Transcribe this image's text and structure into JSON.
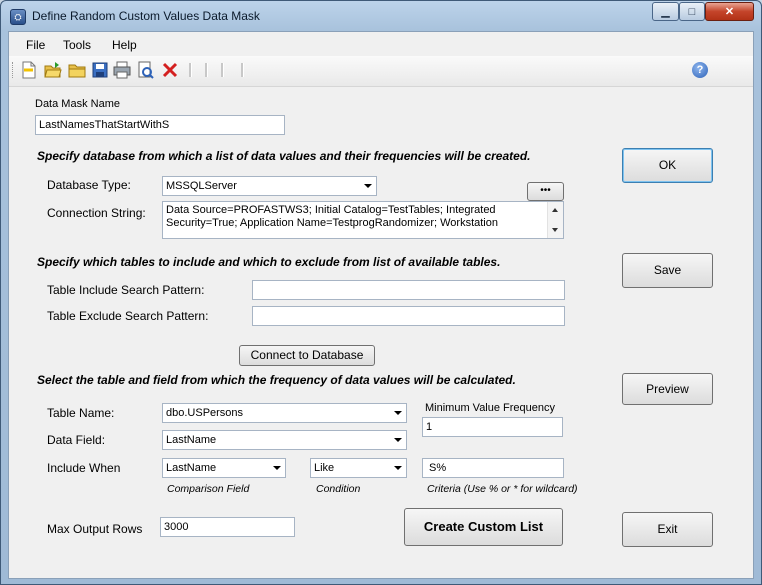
{
  "window": {
    "title": "Define Random Custom Values Data Mask",
    "min_glyph": "▁",
    "max_glyph": "□",
    "close_glyph": "✕"
  },
  "menu": {
    "items": [
      "File",
      "Tools",
      "Help"
    ]
  },
  "toolbar": {
    "icons": [
      "new-document-icon",
      "open-folder-icon",
      "folder-icon",
      "save-icon",
      "print-icon",
      "print-preview-icon",
      "delete-icon",
      "help-icon"
    ],
    "help_glyph": "?"
  },
  "form": {
    "mask_name_label": "Data Mask Name",
    "mask_name_value": "LastNamesThatStartWithS",
    "db_heading": "Specify database from which a list of data values and their frequencies will be created.",
    "db_type_label": "Database Type:",
    "db_type_value": "MSSQLServer",
    "browse_button": "•••",
    "conn_label": "Connection String:",
    "conn_value": "Data Source=PROFASTWS3; Initial Catalog=TestTables; Integrated Security=True; Application Name=TestprogRandomizer; Workstation",
    "tables_heading": "Specify which tables to include and which to exclude from list of available tables.",
    "include_label": "Table Include Search Pattern:",
    "include_value": "",
    "exclude_label": "Table Exclude Search Pattern:",
    "exclude_value": "",
    "connect_button": "Connect to Database",
    "field_heading": "Select the table and field from which the frequency of data values will be calculated.",
    "table_name_label": "Table Name:",
    "table_name_value": "dbo.USPersons",
    "min_freq_label": "Minimum Value Frequency",
    "min_freq_value": "1",
    "data_field_label": "Data Field:",
    "data_field_value": "LastName",
    "include_when_label": "Include When",
    "comparison_value": "LastName",
    "condition_value": "Like",
    "criteria_value": "S%",
    "comparison_caption": "Comparison Field",
    "condition_caption": "Condition",
    "criteria_caption": "Criteria (Use % or * for wildcard)",
    "max_rows_label": "Max Output Rows",
    "max_rows_value": "3000",
    "create_button": "Create Custom  List"
  },
  "side_buttons": {
    "ok": "OK",
    "save": "Save",
    "preview": "Preview",
    "exit": "Exit"
  },
  "colors": {
    "title_bar": "#a8c2dc",
    "close_button": "#c4442a",
    "client_bg": "#f0f0f0"
  }
}
